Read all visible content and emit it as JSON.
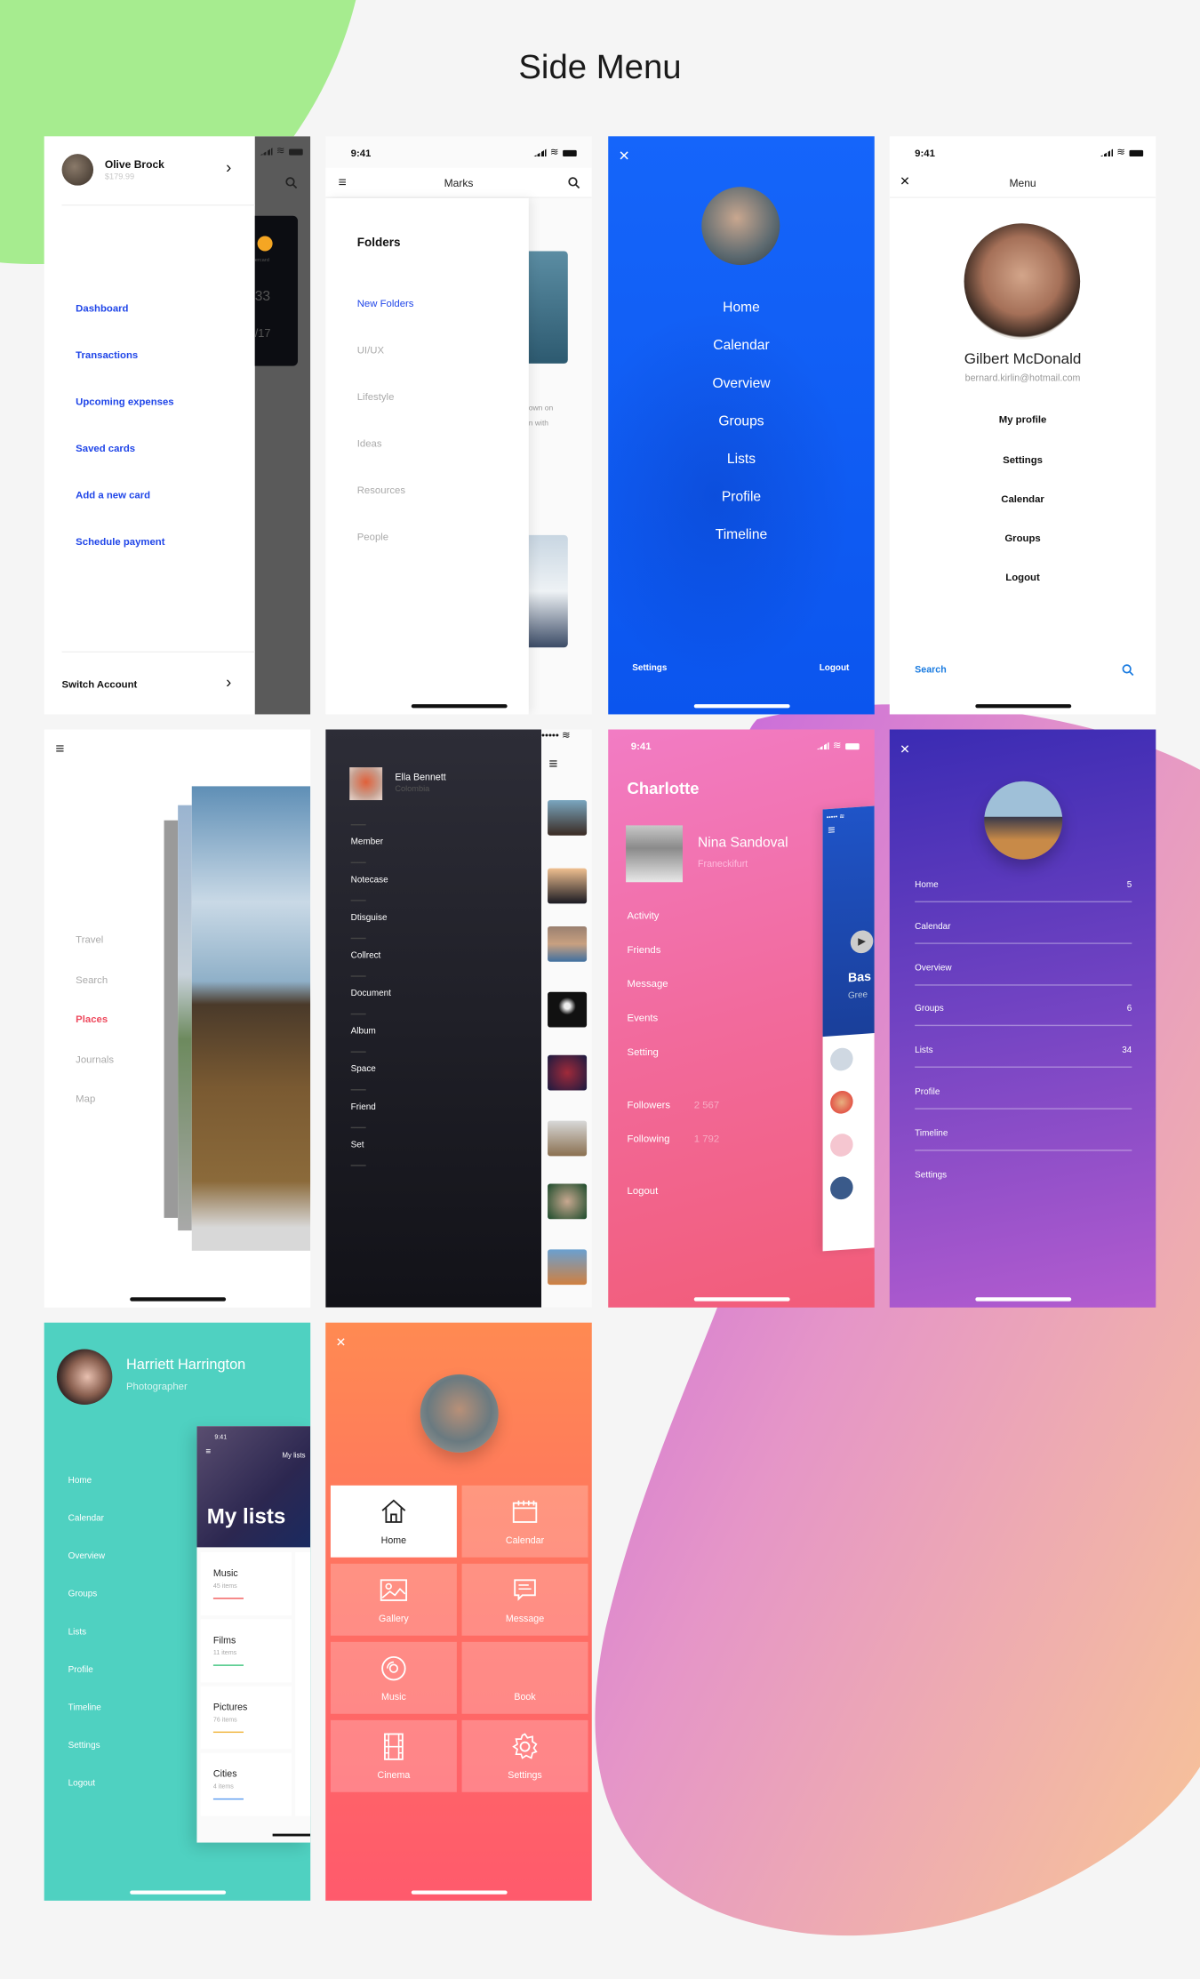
{
  "page_title": "Side Menu",
  "colors": {
    "background": "#f5f5f5",
    "wallet_link": "#1f45e8",
    "blue_panel": "#0f5ef7",
    "travel_active": "#ee4a5e",
    "teal_panel": "#4fd1c1",
    "search_accent": "#1a7be0"
  },
  "wallet": {
    "user_name": "Olive Brock",
    "balance": "$179.99",
    "items": [
      "Dashboard",
      "Transactions",
      "Upcoming expenses",
      "Saved cards",
      "Add a new card",
      "Schedule payment"
    ],
    "switch_account": "Switch Account",
    "card_brand": "ercard",
    "card_digits": "33",
    "card_expiry": "/17"
  },
  "marks": {
    "time": "9:41",
    "title": "Marks",
    "heading": "Folders",
    "items": [
      "New Folders",
      "UI/UX",
      "Lifestyle",
      "Ideas",
      "Resources",
      "People"
    ],
    "active": "New Folders",
    "preview_text": [
      "own on",
      "n with"
    ]
  },
  "blue_menu": {
    "items": [
      "Home",
      "Calendar",
      "Overview",
      "Groups",
      "Lists",
      "Profile",
      "Timeline"
    ],
    "settings": "Settings",
    "logout": "Logout"
  },
  "profile_menu": {
    "time": "9:41",
    "title": "Menu",
    "name": "Gilbert McDonald",
    "email": "bernard.kirlin@hotmail.com",
    "items": [
      "My profile",
      "Settings",
      "Calendar",
      "Groups",
      "Logout"
    ],
    "search": "Search"
  },
  "travel": {
    "items": [
      "Travel",
      "Search",
      "Places",
      "Journals",
      "Map"
    ],
    "active": "Places"
  },
  "dark_menu": {
    "name": "Ella Bennett",
    "location": "Colombia",
    "items": [
      "Member",
      "Notecase",
      "Dtisguise",
      "Collrect",
      "Document",
      "Album",
      "Space",
      "Friend",
      "Set"
    ]
  },
  "pink_menu": {
    "time": "9:41",
    "title": "Charlotte",
    "name": "Nina Sandoval",
    "city": "Franeckifurt",
    "items": [
      "Activity",
      "Friends",
      "Message",
      "Events",
      "Setting"
    ],
    "stats": [
      {
        "label": "Followers",
        "value": "2 567"
      },
      {
        "label": "Following",
        "value": "1 792"
      }
    ],
    "logout": "Logout",
    "preview_title": "Bas",
    "preview_subtitle": "Gree"
  },
  "purple_menu": {
    "items": [
      {
        "label": "Home",
        "count": "5"
      },
      {
        "label": "Calendar",
        "count": ""
      },
      {
        "label": "Overview",
        "count": ""
      },
      {
        "label": "Groups",
        "count": "6"
      },
      {
        "label": "Lists",
        "count": "34"
      },
      {
        "label": "Profile",
        "count": ""
      },
      {
        "label": "Timeline",
        "count": ""
      },
      {
        "label": "Settings",
        "count": ""
      }
    ]
  },
  "teal_menu": {
    "name": "Harriett Harrington",
    "role": "Photographer",
    "items": [
      "Home",
      "Calendar",
      "Overview",
      "Groups",
      "Lists",
      "Profile",
      "Timeline",
      "Settings",
      "Logout"
    ],
    "card": {
      "time": "9:41",
      "small_title": "My lists",
      "title": "My lists",
      "lists": [
        {
          "name": "Music",
          "count": "45 items",
          "color": "#f25a5a"
        },
        {
          "name": "Films",
          "count": "11 items",
          "color": "#3cc47c"
        },
        {
          "name": "Pictures",
          "count": "76 items",
          "color": "#f0b43c"
        },
        {
          "name": "Cities",
          "count": "4 items",
          "color": "#5b9cf0"
        }
      ]
    }
  },
  "tile_menu": {
    "tiles": [
      {
        "label": "Home",
        "icon": "home-icon",
        "active": true
      },
      {
        "label": "Calendar",
        "icon": "calendar-icon",
        "active": false
      },
      {
        "label": "Gallery",
        "icon": "gallery-icon",
        "active": false
      },
      {
        "label": "Message",
        "icon": "message-icon",
        "active": false
      },
      {
        "label": "Music",
        "icon": "music-disc-icon",
        "active": false
      },
      {
        "label": "Book",
        "icon": "book-icon",
        "active": false
      },
      {
        "label": "Cinema",
        "icon": "film-icon",
        "active": false
      },
      {
        "label": "Settings",
        "icon": "gear-icon",
        "active": false
      }
    ]
  }
}
